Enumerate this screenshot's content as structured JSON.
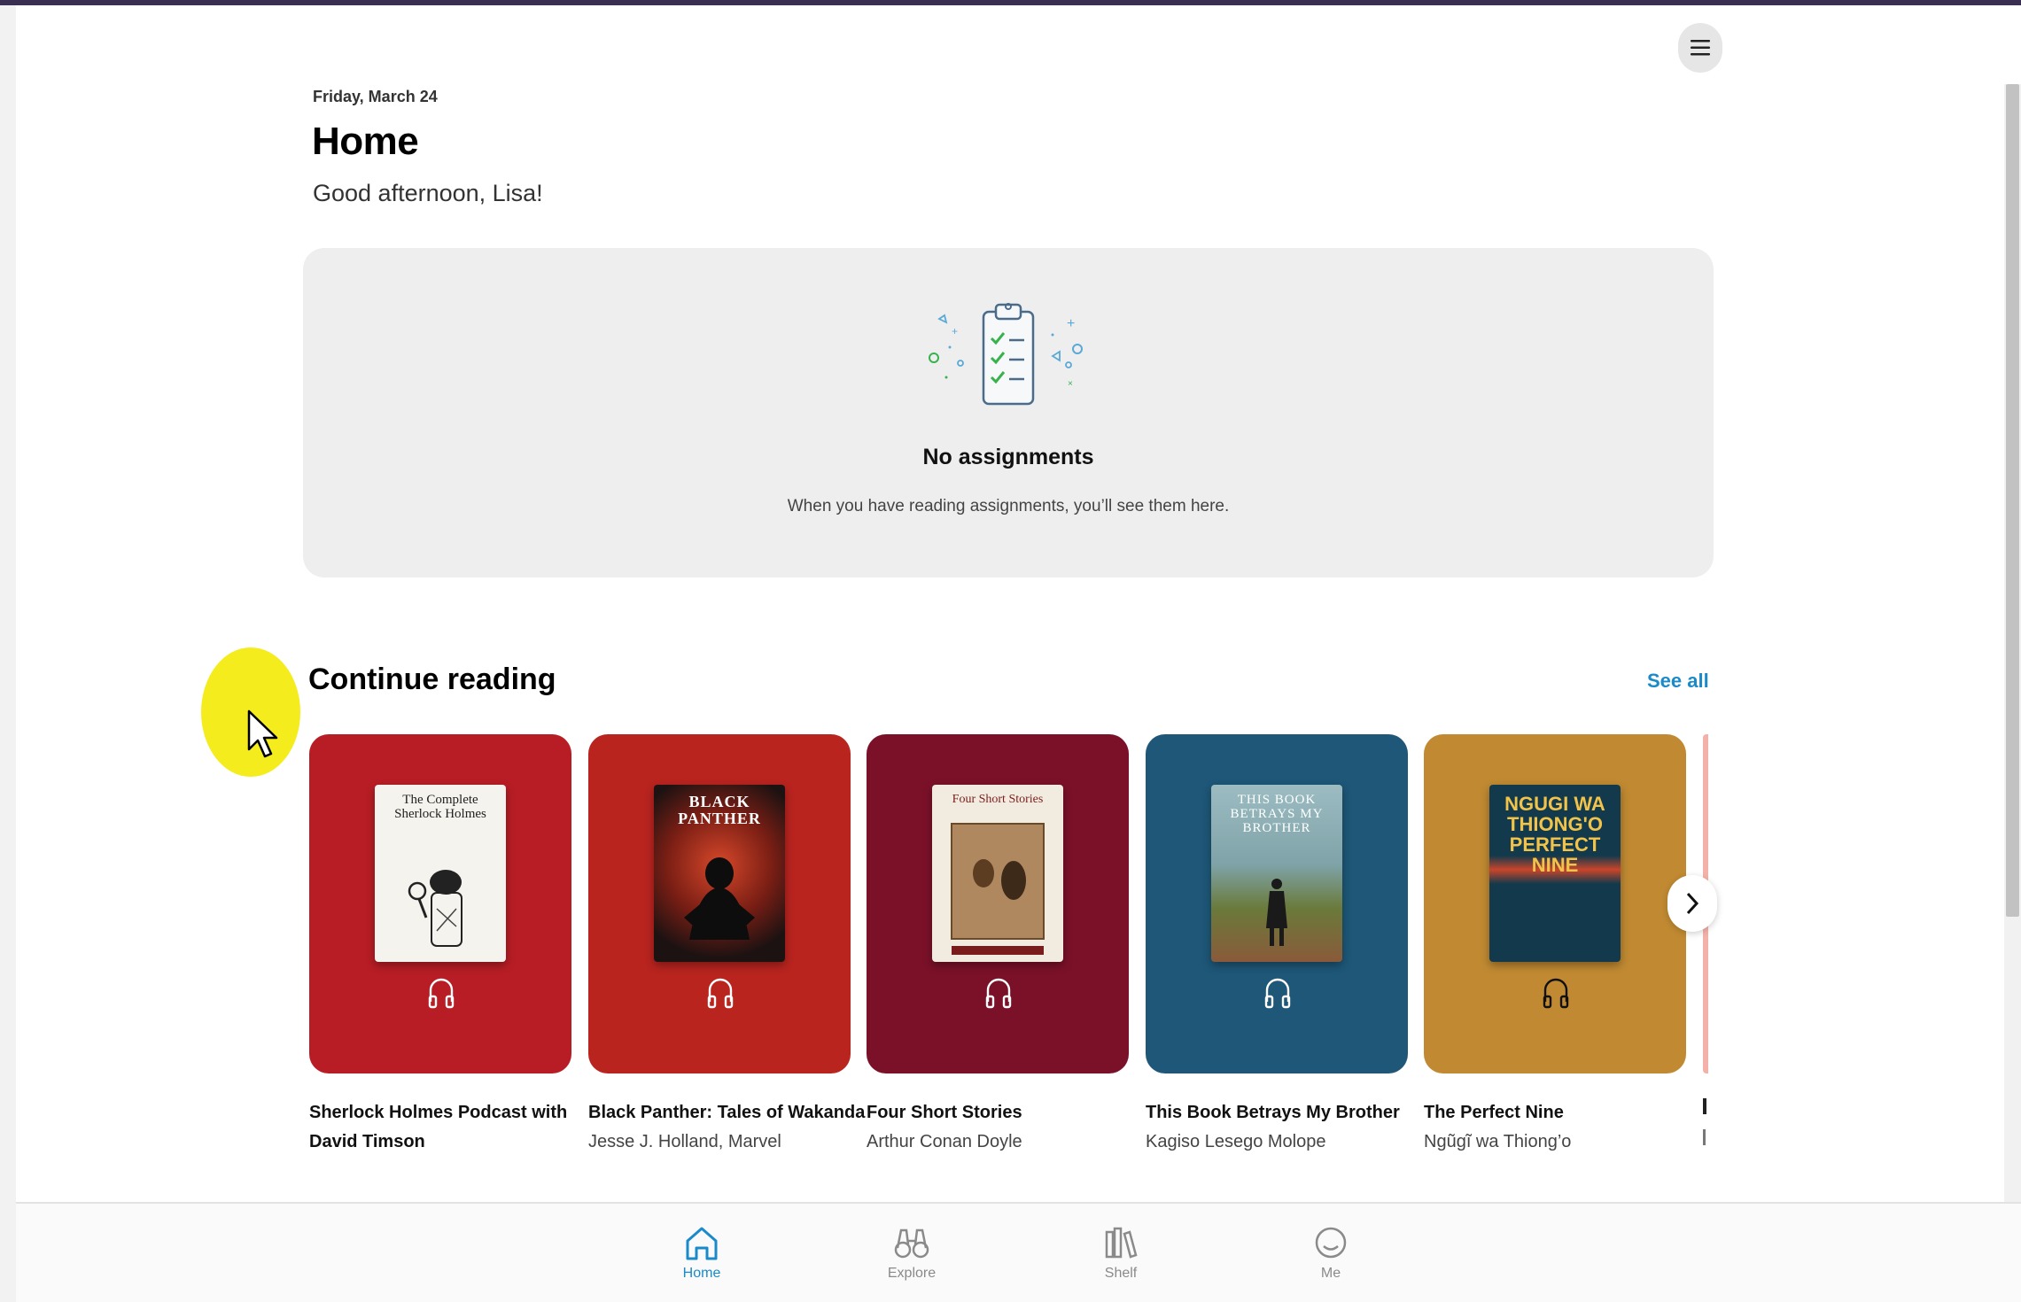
{
  "header": {
    "date": "Friday, March 24",
    "title": "Home",
    "greeting": "Good afternoon, Lisa!",
    "menu_icon": "hamburger-menu-icon"
  },
  "assignments": {
    "title": "No assignments",
    "description": "When you have reading assignments, you’ll see them here.",
    "illustration": "clipboard-checklist-icon"
  },
  "continue_reading": {
    "title": "Continue reading",
    "see_all": "See all",
    "books": [
      {
        "title": "Sherlock Holmes Podcast with David Timson",
        "author": "",
        "card_color": "#b81d25",
        "cover": {
          "bg": "#f5f3ee",
          "fg": "#222",
          "text": "The Complete Sherlock Holmes"
        },
        "format_icon": "headphones-icon"
      },
      {
        "title": "Black Panther: Tales of Wakanda",
        "author": "Jesse J. Holland, Marvel",
        "card_color": "#b9241f",
        "cover": {
          "bg": "#2a1a1a",
          "fg": "#ffffff",
          "text": "BLACK PANTHER"
        },
        "format_icon": "headphones-icon"
      },
      {
        "title": "Four Short Stories",
        "author": "Arthur Conan Doyle",
        "card_color": "#7a1129",
        "cover": {
          "bg": "#f2ece0",
          "fg": "#7a1c1c",
          "text": "Four Short Stories"
        },
        "format_icon": "headphones-icon"
      },
      {
        "title": "This Book Betrays My Brother",
        "author": "Kagiso Lesego Molope",
        "card_color": "#1e5778",
        "cover": {
          "bg": "#7fa3a8",
          "fg": "#ffffff",
          "text": "THIS BOOK BETRAYS MY BROTHER"
        },
        "format_icon": "headphones-icon"
      },
      {
        "title": "The Perfect Nine",
        "author": "Ngũgĩ wa Thiong’o",
        "card_color": "#c18a32",
        "cover": {
          "bg": "#123a4c",
          "fg": "#f2c34a",
          "text": "NGUGI WA THIONG'O PERFECT NINE"
        },
        "format_icon": "headphones-icon"
      }
    ]
  },
  "bottom_nav": {
    "items": [
      {
        "label": "Home",
        "icon": "home-icon",
        "active": true
      },
      {
        "label": "Explore",
        "icon": "binoculars-icon",
        "active": false
      },
      {
        "label": "Shelf",
        "icon": "bookshelf-icon",
        "active": false
      },
      {
        "label": "Me",
        "icon": "face-icon",
        "active": false
      }
    ]
  },
  "colors": {
    "accent": "#1b8ac9",
    "card_bg": "#eeeeef",
    "cursor_highlight": "#f5ec1d"
  }
}
